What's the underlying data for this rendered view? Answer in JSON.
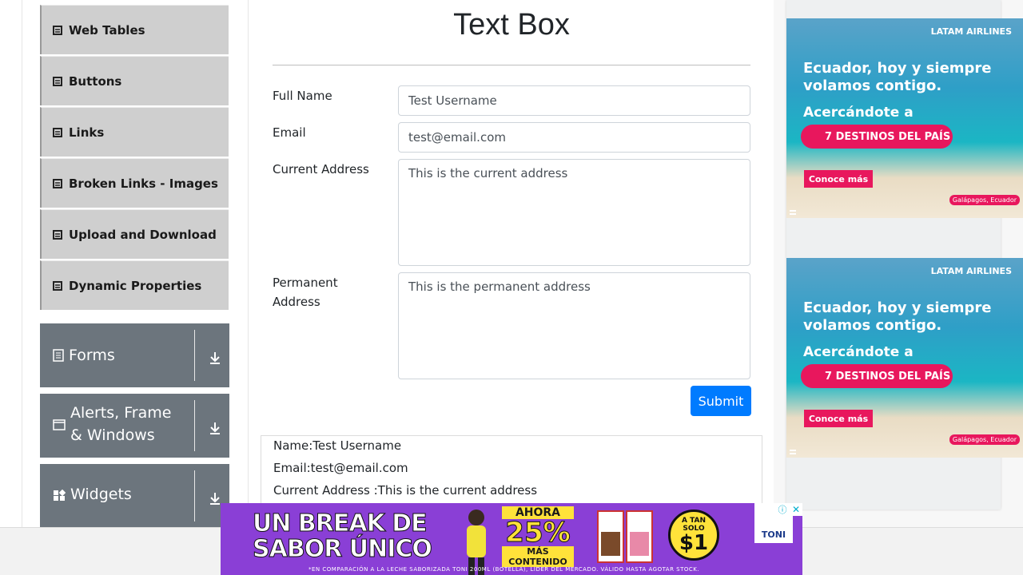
{
  "sidebar": {
    "items": [
      {
        "label": "Web Tables"
      },
      {
        "label": "Buttons"
      },
      {
        "label": "Links"
      },
      {
        "label": "Broken Links - Images"
      },
      {
        "label": "Upload and Download"
      },
      {
        "label": "Dynamic Properties"
      }
    ],
    "groups": [
      {
        "label": "Forms",
        "icon": "form-icon"
      },
      {
        "label": "Alerts, Frame & Windows",
        "icon": "window-icon"
      },
      {
        "label": "Widgets",
        "icon": "widgets-icon"
      }
    ]
  },
  "main": {
    "title": "Text Box",
    "fields": {
      "full_name": {
        "label": "Full Name",
        "value": "Test Username"
      },
      "email": {
        "label": "Email",
        "value": "test@email.com"
      },
      "current_address": {
        "label": "Current Address",
        "value": "This is the current address"
      },
      "permanent_address": {
        "label": "Permanent Address",
        "value": "This is the permanent address"
      }
    },
    "submit_label": "Submit",
    "output": {
      "name": "Name:Test Username",
      "email": "Email:test@email.com",
      "current_address": "Current Address :This is the current address"
    }
  },
  "ads": {
    "side": {
      "brand": "LATAM AIRLINES",
      "headline": "Ecuador, hoy y siempre volamos contigo.",
      "subhead": "Acercándote a",
      "pill": "7 DESTINOS DEL PAÍS",
      "cta": "Conoce más",
      "location": "Galápagos, Ecuador"
    },
    "banner": {
      "headline": "UN BREAK DE SABOR ÚNICO",
      "promo_top": "AHORA",
      "promo_big": "25%",
      "promo_bottom": "MÁS CONTENIDO",
      "price_top": "A TAN SOLO",
      "price": "$1",
      "brand": "TONI",
      "footnote": "*EN COMPARACIÓN A LA LECHE SABORIZADA TONI 200ML (BOTELLA), LÍDER DEL MERCADO. VÁLIDO HASTA AGOTAR STOCK."
    }
  },
  "colors": {
    "primary": "#007bff",
    "sidebar_item": "#cfcfcf",
    "group_header": "#6c757d",
    "ad_pink": "#e8175d",
    "banner_purple": "#8a3fd6"
  }
}
